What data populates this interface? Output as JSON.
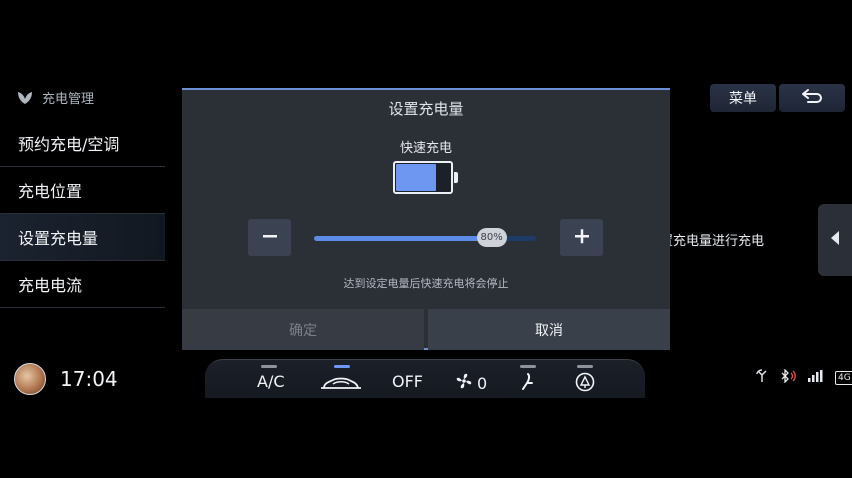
{
  "sidebar": {
    "header_label": "充电管理",
    "items": [
      {
        "label": "预约充电/空调"
      },
      {
        "label": "充电位置"
      },
      {
        "label": "设置充电量"
      },
      {
        "label": "充电电流"
      }
    ]
  },
  "topbar": {
    "menu_label": "菜单",
    "back_icon": "back-arrow-icon"
  },
  "background": {
    "partial_text": "置充电量进行充电"
  },
  "dialog": {
    "title": "设置充电量",
    "mode_label": "快速充电",
    "battery_level": 0.8,
    "slider_value": 80,
    "slider_label": "80%",
    "minus_label": "−",
    "plus_label": "+",
    "hint": "达到设定电量后快速充电将会停止",
    "confirm_label": "确定",
    "cancel_label": "取消"
  },
  "bottom_bar": {
    "time": "17:04",
    "climate": {
      "ac_label": "A/C",
      "power_label": "OFF",
      "fan_speed": "0"
    },
    "status": {
      "network_label": "4G"
    }
  },
  "colors": {
    "accent": "#6d97f0",
    "dialog_bg": "#2b2f36",
    "border_accent": "#6a8fd6"
  }
}
